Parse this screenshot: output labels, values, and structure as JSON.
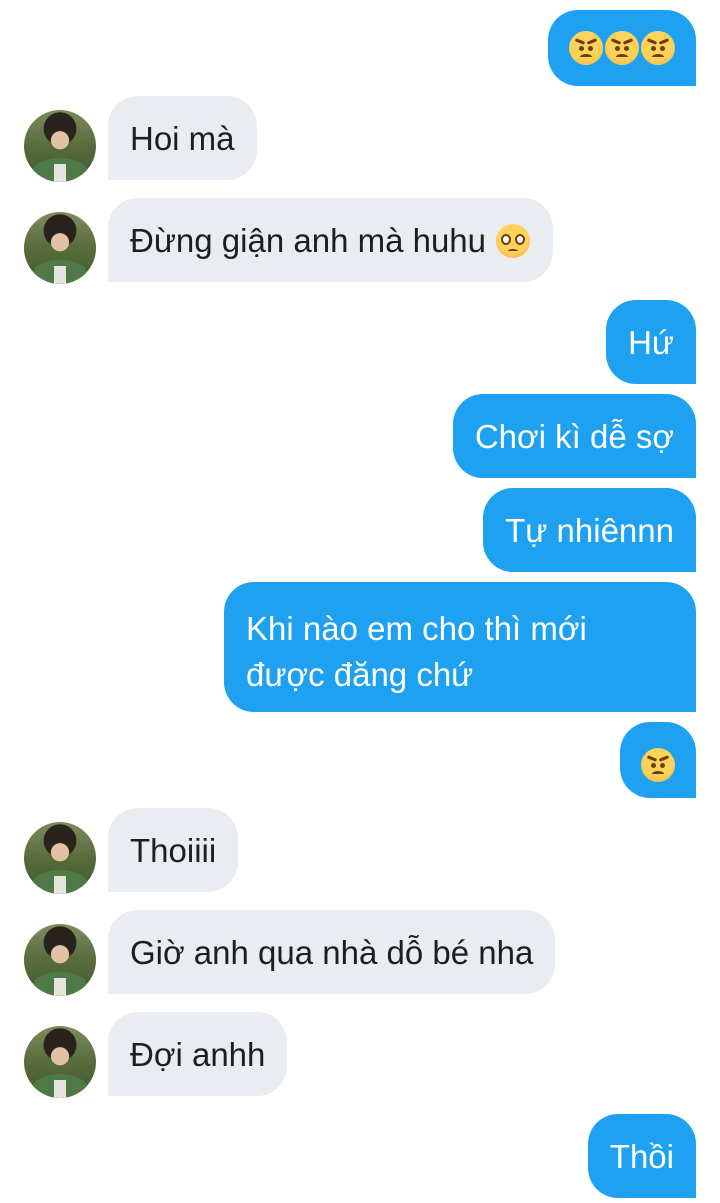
{
  "colors": {
    "sent_bubble": "#1ea1f1",
    "received_bubble": "#e9ecf0",
    "sent_text": "#ffffff",
    "received_text": "#1c1e21"
  },
  "messages": [
    {
      "side": "sent",
      "text": "",
      "emoji": [
        "pouting-face",
        "pouting-face",
        "pouting-face"
      ]
    },
    {
      "side": "received",
      "text": "Hoi mà"
    },
    {
      "side": "received",
      "text": "Đừng giận anh mà huhu",
      "emoji": [
        "pleading-face"
      ]
    },
    {
      "side": "sent",
      "text": "Hứ"
    },
    {
      "side": "sent",
      "text": "Chơi kì dễ sợ"
    },
    {
      "side": "sent",
      "text": "Tự nhiênnn"
    },
    {
      "side": "sent",
      "text": "Khi nào em cho thì mới được đăng chứ"
    },
    {
      "side": "sent",
      "text": "",
      "emoji": [
        "pouting-face"
      ]
    },
    {
      "side": "received",
      "text": "Thoiiii"
    },
    {
      "side": "received",
      "text": "Giờ anh qua nhà dỗ bé nha"
    },
    {
      "side": "received",
      "text": "Đợi anhh"
    },
    {
      "side": "sent",
      "text": "Thồi"
    }
  ]
}
